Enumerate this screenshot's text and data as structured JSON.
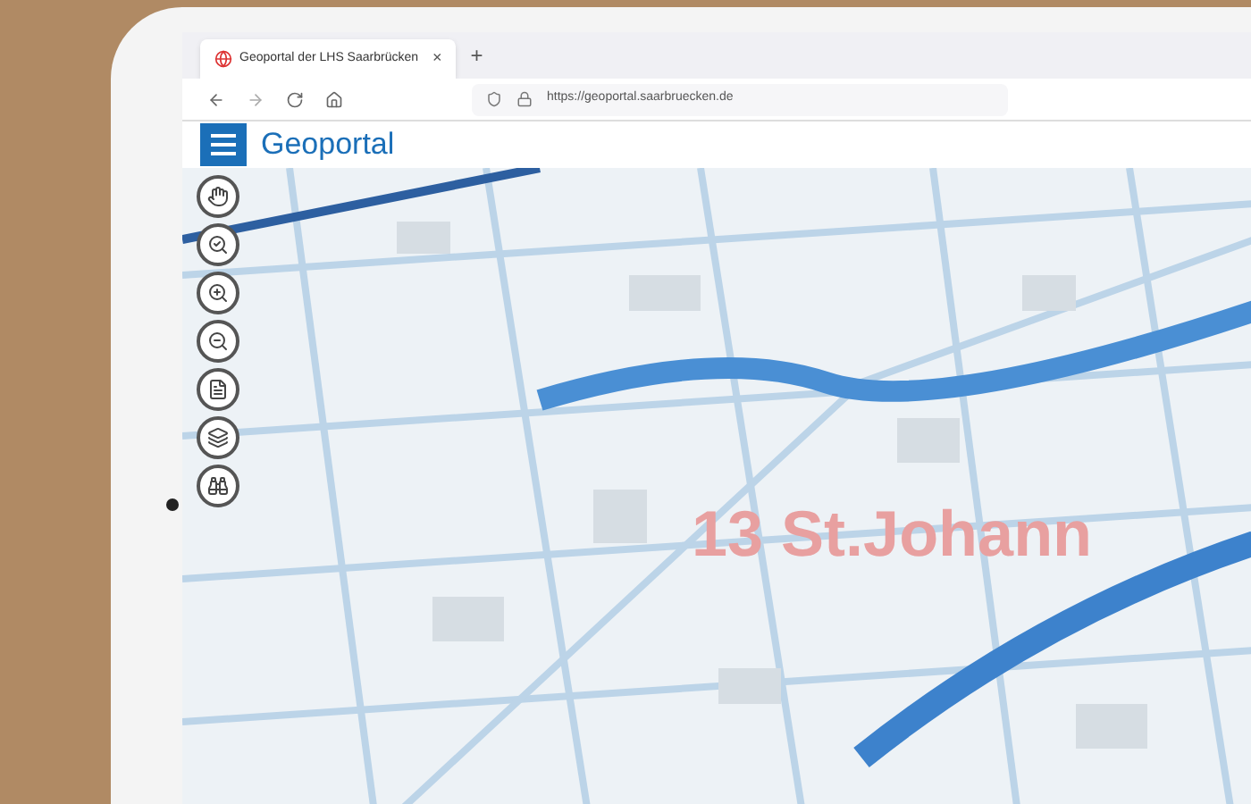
{
  "browser": {
    "tab": {
      "title": "Geoportal der LHS Saarbrücken",
      "close": "×",
      "selected": true
    },
    "new_tab": "+",
    "address": "https://geoportal.saarbruecken.de"
  },
  "app": {
    "title": "Geoportal"
  },
  "map": {
    "label": "13 St.Johann"
  }
}
